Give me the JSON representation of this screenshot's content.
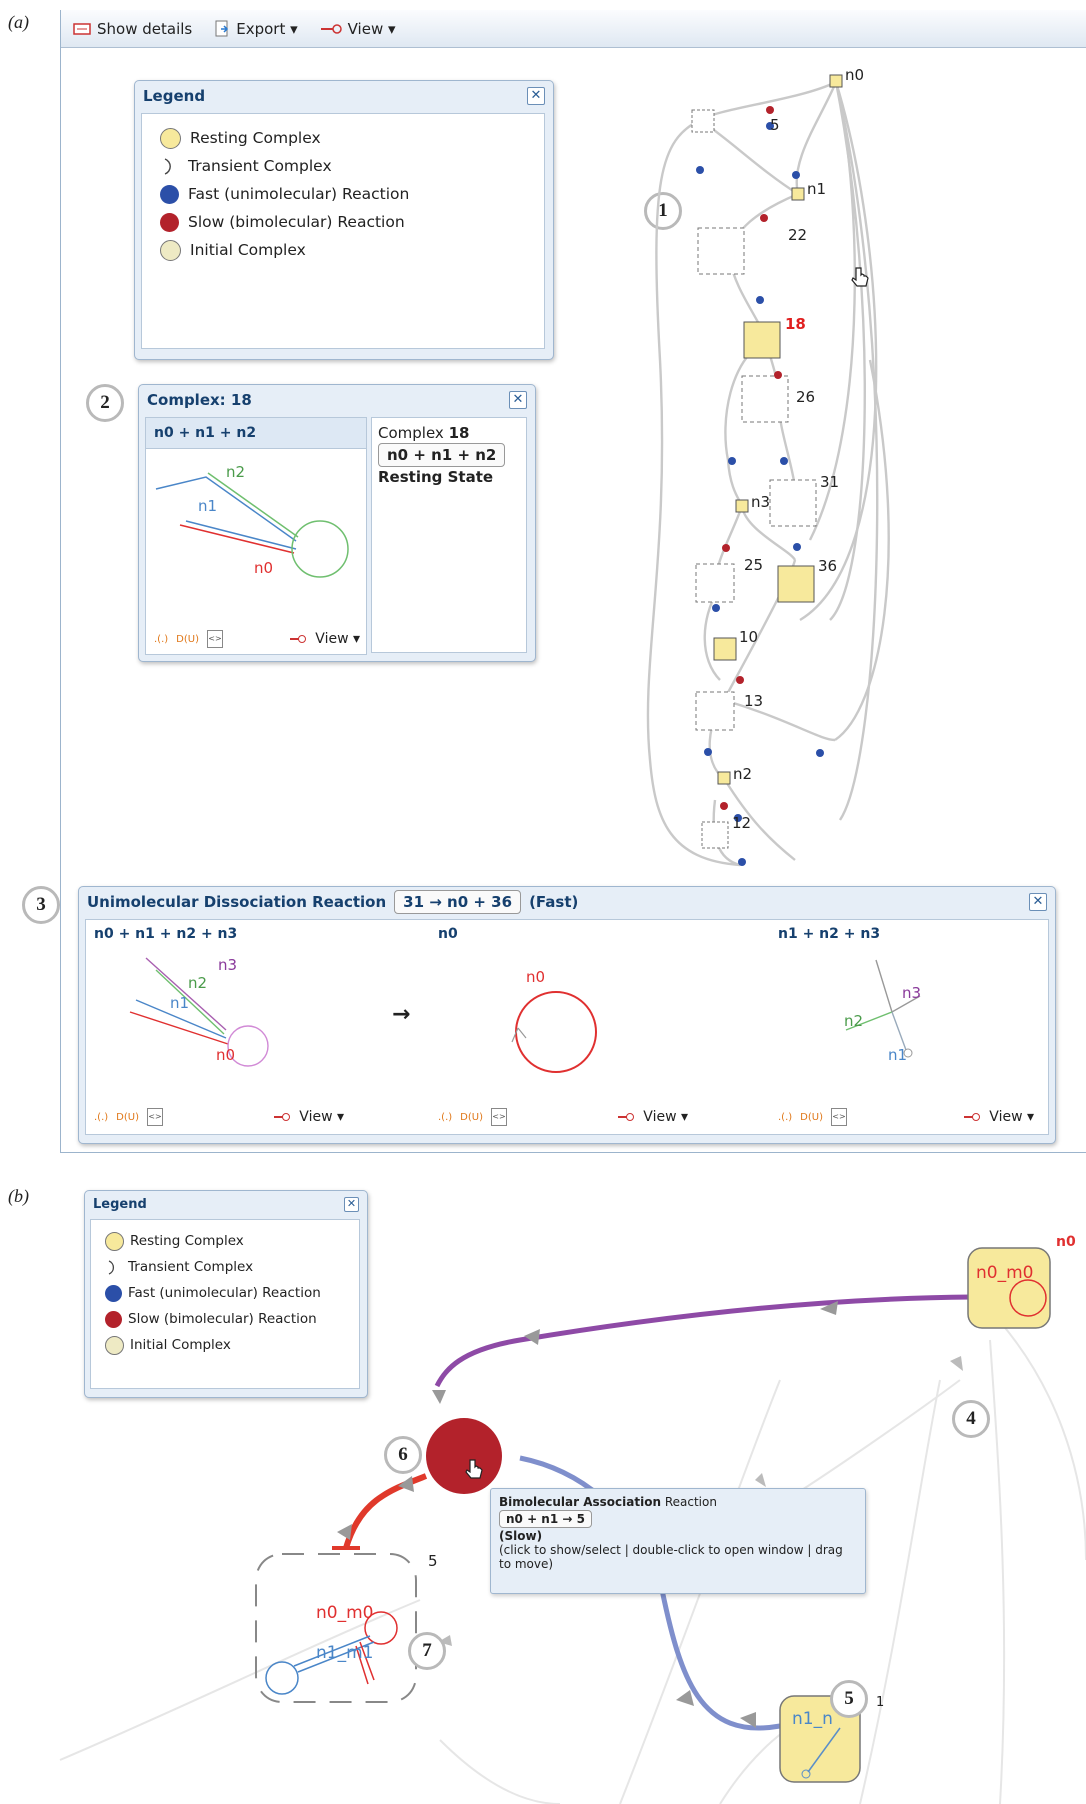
{
  "panel_a_label": "(a)",
  "panel_b_label": "(b)",
  "toolbar": {
    "show_details": "Show details",
    "export": "Export ▾",
    "view": "View ▾"
  },
  "legend": {
    "title": "Legend",
    "close": "✕",
    "items": [
      {
        "label": "Resting Complex",
        "icon": "yellow-circle",
        "color": "#f7e99c"
      },
      {
        "label": "Transient Complex",
        "icon": "open-arc",
        "color": "#555555"
      },
      {
        "label": "Fast (unimolecular) Reaction",
        "icon": "blue-dot",
        "color": "#2b4fa8"
      },
      {
        "label": "Slow (bimolecular) Reaction",
        "icon": "red-dot",
        "color": "#b3222b"
      },
      {
        "label": "Initial Complex",
        "icon": "pale-circle",
        "color": "#eeeac4"
      }
    ]
  },
  "callouts": [
    "1",
    "2",
    "3",
    "4",
    "5",
    "6",
    "7"
  ],
  "graph_labels": {
    "n0": "n0",
    "n1": "n1",
    "n2": "n2",
    "n3": "n3",
    "c5": "5",
    "c22": "22",
    "c18": "18",
    "c26": "26",
    "c31": "31",
    "c25": "25",
    "c36": "36",
    "c10": "10",
    "c13": "13",
    "c12": "12"
  },
  "complex_window": {
    "title": "Complex: 18",
    "header": "n0 + n1 + n2",
    "strands": [
      "n2",
      "n1",
      "n0"
    ],
    "info_prefix": "Complex",
    "info_number": "18",
    "info_formula": "n0 + n1 + n2",
    "info_state": "Resting State",
    "foot_dotparen": ".(.)",
    "foot_du": "D(U)",
    "foot_code": "<>",
    "foot_view": "View ▾"
  },
  "reaction_window": {
    "title": "Unimolecular Dissociation Reaction",
    "formula": "31 → n0 + 36",
    "speed": "(Fast)",
    "columns": [
      {
        "header": "n0 + n1 + n2 + n3",
        "strands": [
          "n3",
          "n2",
          "n1",
          "n0"
        ]
      },
      {
        "header": "n0",
        "strands": [
          "n0"
        ]
      },
      {
        "header": "n1 + n2 + n3",
        "strands": [
          "n3",
          "n2",
          "n1"
        ]
      }
    ],
    "arrow": "→",
    "foot_dotparen": ".(.)",
    "foot_du": "D(U)",
    "foot_code": "<>",
    "foot_view": "View ▾"
  },
  "panel_b": {
    "n0_label": "n0",
    "node_n0_m0": "n0_m0",
    "node_n1_partial": "n1_n",
    "node_5_sup": "1",
    "complex5_label": "5",
    "complex5_top": "n0_m0",
    "complex5_mid": "n1_m1",
    "tooltip": {
      "title_bold": "Bimolecular Association",
      "title_rest": " Reaction",
      "formula": "n0 + n1 → 5",
      "speed": "(Slow)",
      "hint": "(click to show/select | double-click to open window | drag to move)"
    }
  },
  "colors": {
    "resting": "#f7e99c",
    "fast": "#2b4fa8",
    "slow": "#b3222b",
    "purple_edge": "#8e4aa6",
    "red_edge": "#d9352a",
    "blue_edge": "#7f8fcc"
  }
}
